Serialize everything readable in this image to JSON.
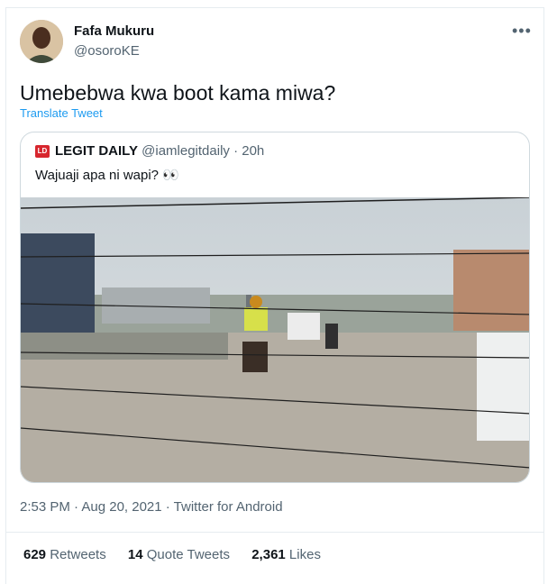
{
  "tweet": {
    "author_name": "Fafa Mukuru",
    "author_handle": "@osoroKE",
    "more": "•••",
    "text": "Umebebwa kwa boot kama miwa?",
    "translate": "Translate Tweet",
    "timestamp": "2:53 PM · Aug 20, 2021 · Twitter for Android"
  },
  "quoted": {
    "logo": "LD",
    "name": "LEGIT DAILY",
    "meta": " @iamlegitdaily · 20h",
    "text": "Wajuaji apa ni wapi? 👀"
  },
  "stats": {
    "retweets_count": "629",
    "retweets_label": " Retweets",
    "quotes_count": "14",
    "quotes_label": " Quote Tweets",
    "likes_count": "2,361",
    "likes_label": " Likes"
  },
  "colors": {
    "accent": "#1d9bf0",
    "secondary_text": "#536471",
    "border": "#cfd9de"
  }
}
